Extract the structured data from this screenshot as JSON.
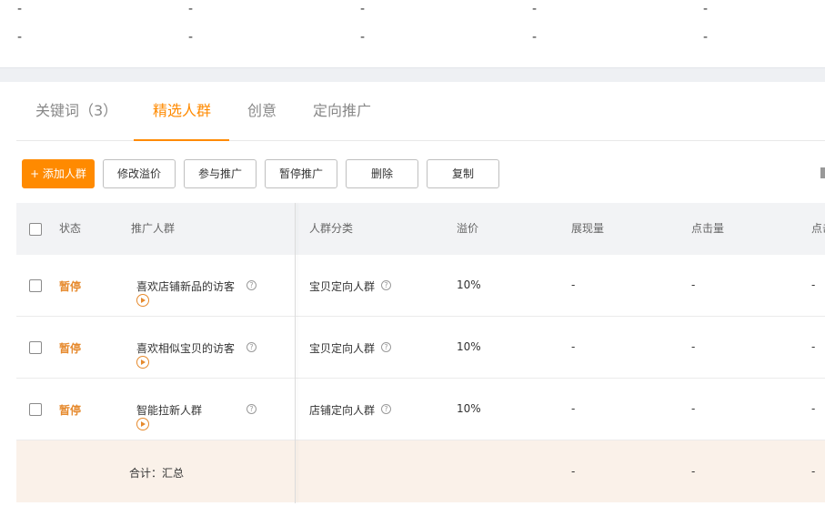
{
  "summary": {
    "dash": "-"
  },
  "tabs": [
    {
      "label": "关键词（3）"
    },
    {
      "label": "精选人群"
    },
    {
      "label": "创意"
    },
    {
      "label": "定向推广"
    }
  ],
  "toolbar": {
    "add_label": "+ 添加人群",
    "modify_label": "修改溢价",
    "join_label": "参与推广",
    "pause_label": "暂停推广",
    "delete_label": "删除",
    "copy_label": "复制"
  },
  "table": {
    "headers": [
      "状态",
      "推广人群",
      "人群分类",
      "溢价",
      "展现量",
      "点击量",
      "点击"
    ],
    "rows": [
      {
        "status": "暂停",
        "name": "喜欢店铺新品的访客",
        "category": "宝贝定向人群",
        "premium": "10%",
        "impressions": "-",
        "clicks": "-",
        "ctr": "-"
      },
      {
        "status": "暂停",
        "name": "喜欢相似宝贝的访客",
        "category": "宝贝定向人群",
        "premium": "10%",
        "impressions": "-",
        "clicks": "-",
        "ctr": "-"
      },
      {
        "status": "暂停",
        "name": "智能拉新人群",
        "category": "店铺定向人群",
        "premium": "10%",
        "impressions": "-",
        "clicks": "-",
        "ctr": "-"
      }
    ],
    "total": {
      "label": "合计：汇总",
      "impressions": "-",
      "clicks": "-",
      "ctr": "-"
    }
  },
  "colors": {
    "accent": "#ff8a00",
    "status": "#e68a2e"
  }
}
